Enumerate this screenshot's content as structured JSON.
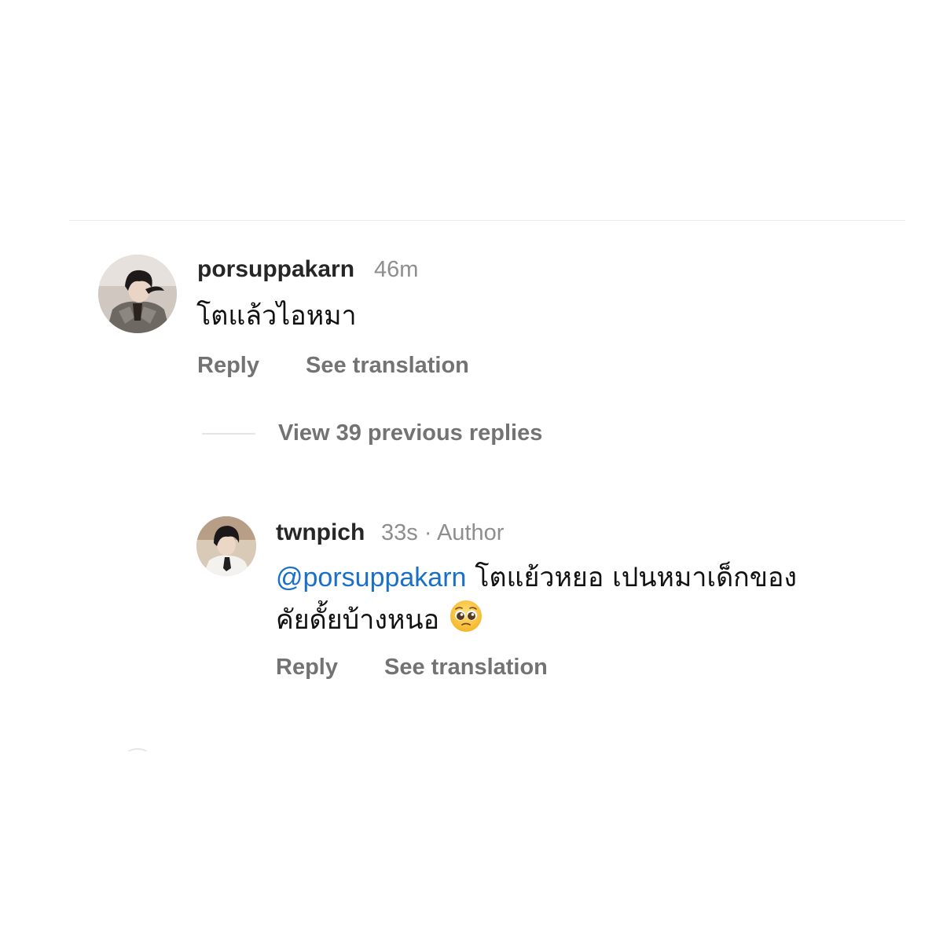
{
  "comment": {
    "username": "porsuppakarn",
    "time": "46m",
    "text": "โตแล้วไอหมา",
    "reply_label": "Reply",
    "translate_label": "See translation",
    "avatar_icon": "profile-photo"
  },
  "view_replies": {
    "label": "View 39 previous replies"
  },
  "reply": {
    "username": "twnpich",
    "time": "33s",
    "separator": "·",
    "author_badge": "Author",
    "mention": "@porsuppakarn",
    "text_line1": "โตแย้วหยอ เปนหมาเด็กของ",
    "text_line2": "คัยดั้ยบ้างหนอ",
    "emoji": "pleading-face-emoji",
    "reply_label": "Reply",
    "translate_label": "See translation",
    "avatar_icon": "profile-photo"
  },
  "colors": {
    "mention": "#1a6fc9",
    "username": "#262626",
    "secondary": "#8e8e8e",
    "action": "#737373"
  }
}
